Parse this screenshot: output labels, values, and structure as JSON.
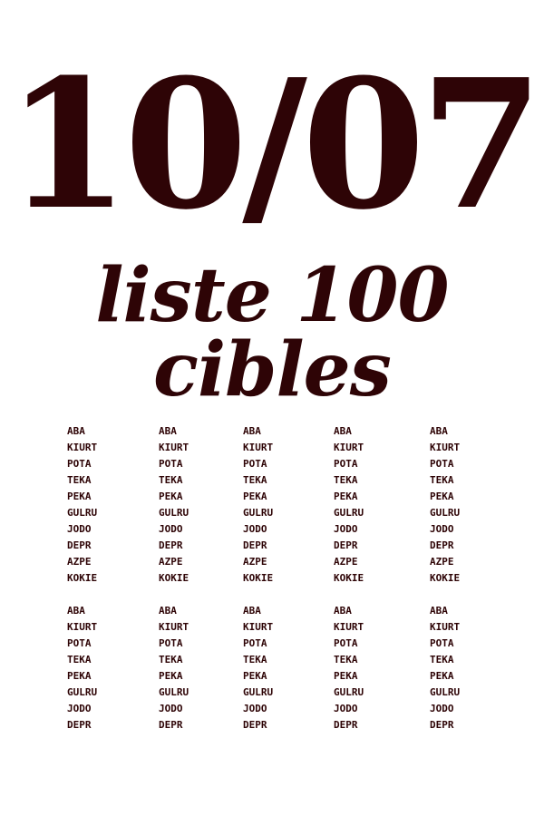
{
  "header": {
    "date": "10/07",
    "subtitle": "liste 100 cibles"
  },
  "word_block_1": [
    "ABA",
    "KIURT",
    "POTA",
    "TEKA",
    "PEKA",
    "GULRU",
    "JODO",
    "DEPR",
    "AZPE",
    "KOKIE"
  ],
  "word_block_2": [
    "ABA",
    "KIURT",
    "POTA",
    "TEKA",
    "PEKA",
    "GULRU",
    "JODO",
    "DEPR"
  ]
}
